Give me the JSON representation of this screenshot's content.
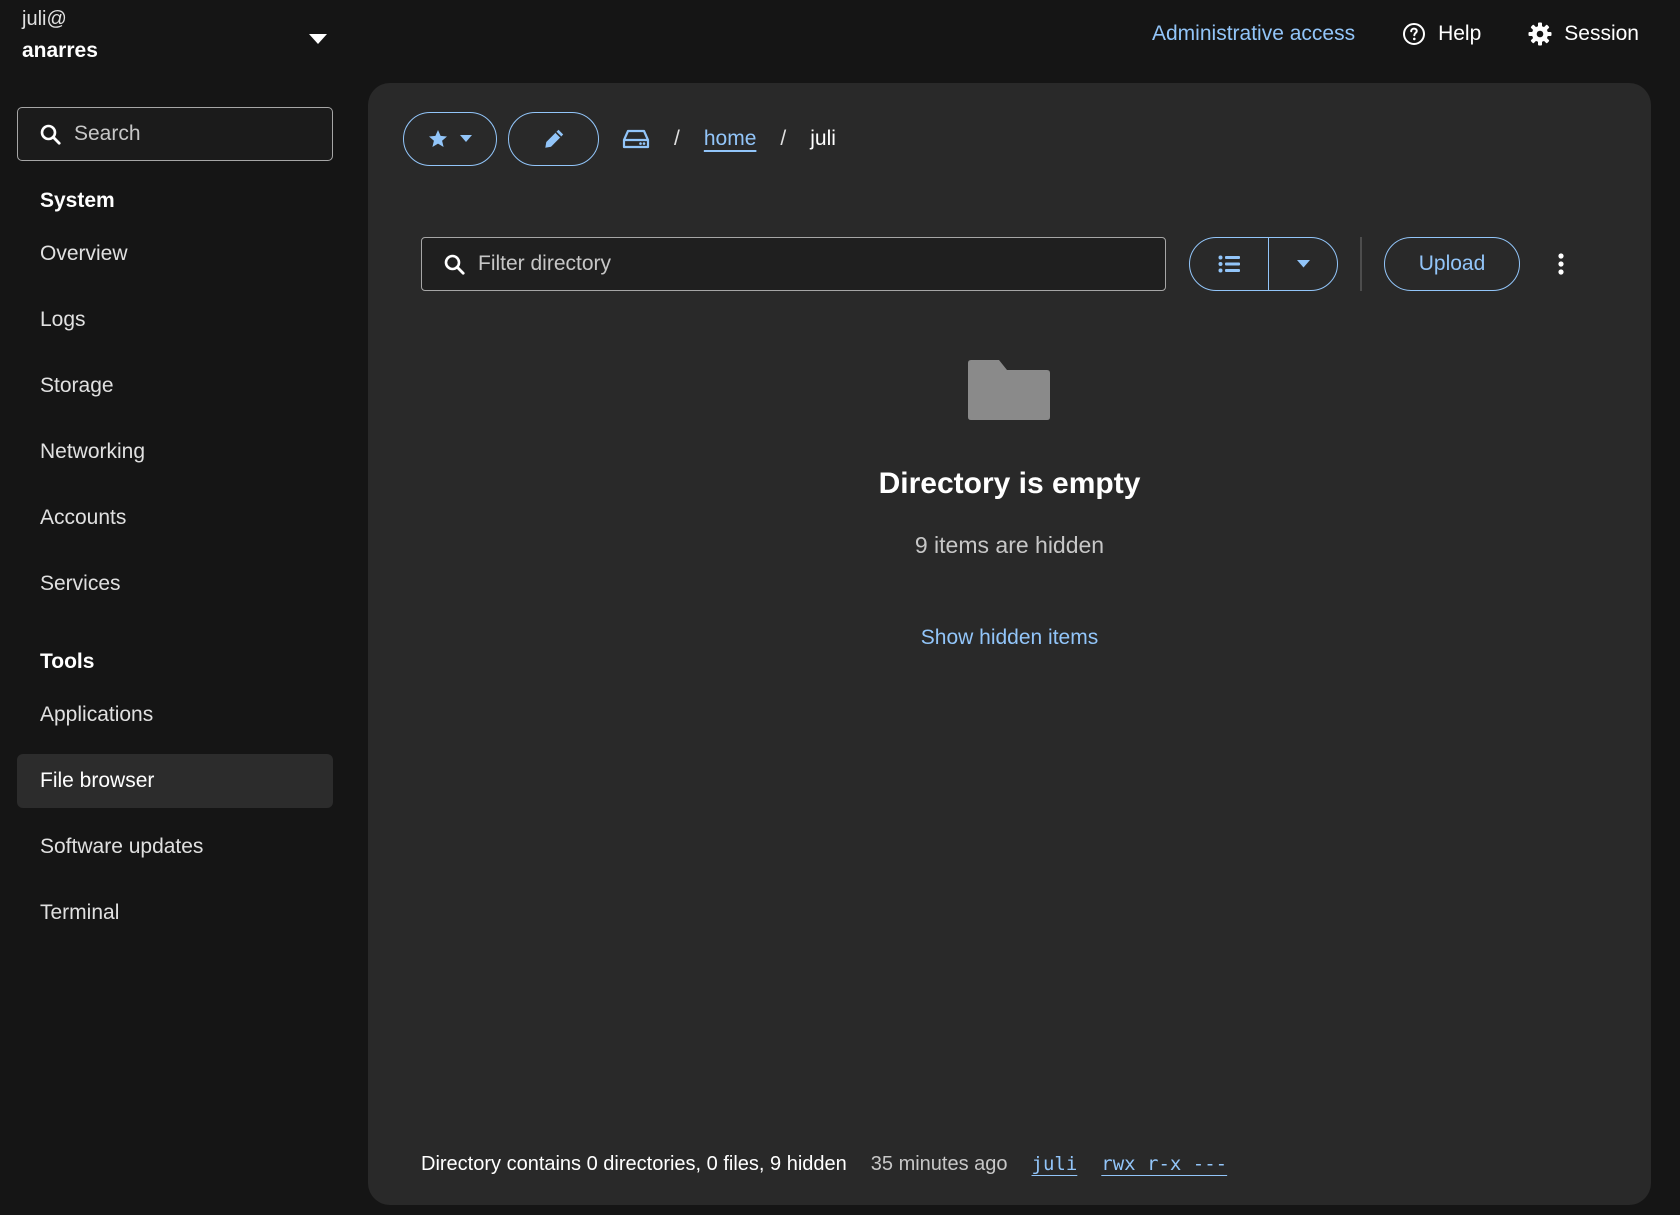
{
  "host": {
    "user": "juli@",
    "hostname": "anarres",
    "caret_icon": "caret-down-icon"
  },
  "topnav": {
    "admin_access": "Administrative access",
    "help": "Help",
    "session": "Session"
  },
  "sidebar": {
    "search_placeholder": "Search",
    "sections": [
      {
        "title": "System",
        "items": [
          {
            "label": "Overview"
          },
          {
            "label": "Logs"
          },
          {
            "label": "Storage"
          },
          {
            "label": "Networking"
          },
          {
            "label": "Accounts"
          },
          {
            "label": "Services"
          }
        ]
      },
      {
        "title": "Tools",
        "items": [
          {
            "label": "Applications"
          },
          {
            "label": "File browser",
            "active": true
          },
          {
            "label": "Software updates"
          },
          {
            "label": "Terminal"
          }
        ]
      }
    ]
  },
  "breadcrumb": {
    "root_icon": "drive-icon",
    "separator": "/",
    "items": [
      "home",
      "juli"
    ]
  },
  "toolbar": {
    "filter_placeholder": "Filter directory",
    "view_mode_icon": "list-icon",
    "upload_label": "Upload"
  },
  "empty_state": {
    "title": "Directory is empty",
    "subtitle": "9 items are hidden",
    "action": "Show hidden items"
  },
  "footer": {
    "summary": "Directory contains 0 directories, 0 files, 9 hidden",
    "modified": "35 minutes ago",
    "owner": "juli",
    "permissions": "rwx r-x ---"
  },
  "colors": {
    "background": "#151515",
    "panel": "#292929",
    "accent": "#92c5f9",
    "active_nav": "#2c2c2c"
  }
}
